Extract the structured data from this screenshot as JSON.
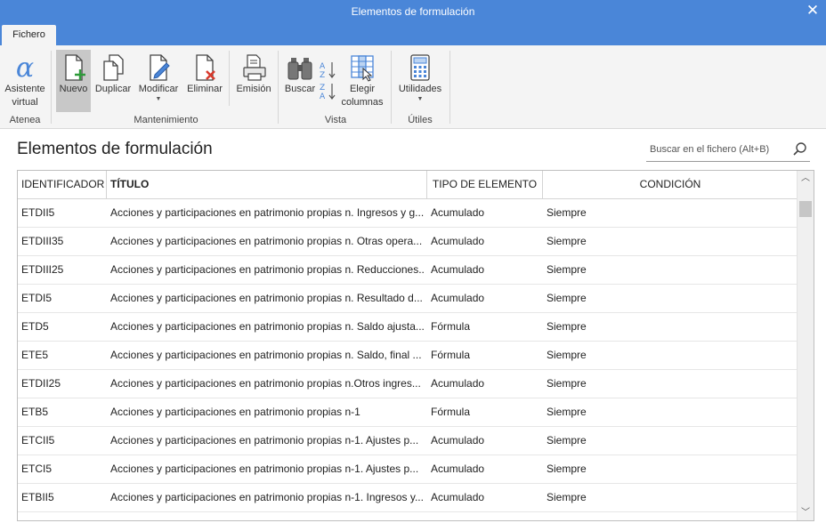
{
  "window": {
    "title": "Elementos de formulación",
    "close_glyph": "✕"
  },
  "tabs": [
    {
      "label": "Fichero"
    }
  ],
  "ribbon": {
    "groups": [
      {
        "label": "Atenea"
      },
      {
        "label": "Mantenimiento"
      },
      {
        "label": "Vista"
      },
      {
        "label": "Útiles"
      }
    ],
    "buttons": {
      "asistente": {
        "label1": "Asistente",
        "label2": "virtual",
        "icon": "alpha-icon"
      },
      "nuevo": {
        "label": "Nuevo",
        "icon": "new-document-icon"
      },
      "duplicar": {
        "label": "Duplicar",
        "icon": "duplicate-icon"
      },
      "modificar": {
        "label": "Modificar",
        "icon": "edit-document-icon"
      },
      "eliminar": {
        "label": "Eliminar",
        "icon": "delete-document-icon"
      },
      "emision": {
        "label": "Emisión",
        "icon": "printer-icon"
      },
      "buscar": {
        "label": "Buscar",
        "icon": "binoculars-icon"
      },
      "ordenar": {
        "icon": "sort-az-icon"
      },
      "elegir": {
        "label1": "Elegir",
        "label2": "columnas",
        "icon": "choose-columns-icon"
      },
      "utilidades": {
        "label": "Utilidades",
        "icon": "calculator-icon"
      }
    },
    "accent_green": "#2e9b3a",
    "accent_red": "#d83b2e",
    "accent_blue": "#4a86d8"
  },
  "page": {
    "heading": "Elementos de formulación",
    "search_placeholder": "Buscar en el fichero (Alt+B)"
  },
  "table": {
    "columns": [
      "IDENTIFICADOR",
      "TÍTULO",
      "TIPO DE ELEMENTO",
      "CONDICIÓN"
    ],
    "rows": [
      [
        "ETDII5",
        "Acciones y participaciones en patrimonio propias n. Ingresos y g...",
        "Acumulado",
        "Siempre"
      ],
      [
        "ETDIII35",
        "Acciones y participaciones en patrimonio propias n. Otras opera...",
        "Acumulado",
        "Siempre"
      ],
      [
        "ETDIII25",
        "Acciones y participaciones en patrimonio propias n. Reducciones...",
        "Acumulado",
        "Siempre"
      ],
      [
        "ETDI5",
        "Acciones y participaciones en patrimonio propias n. Resultado d...",
        "Acumulado",
        "Siempre"
      ],
      [
        "ETD5",
        "Acciones y participaciones en patrimonio propias n. Saldo ajusta...",
        "Fórmula",
        "Siempre"
      ],
      [
        "ETE5",
        "Acciones y participaciones en patrimonio propias n. Saldo, final ...",
        "Fórmula",
        "Siempre"
      ],
      [
        "ETDII25",
        "Acciones y participaciones en patrimonio propias n.Otros ingres...",
        "Acumulado",
        "Siempre"
      ],
      [
        "ETB5",
        "Acciones y participaciones en patrimonio propias n-1",
        "Fórmula",
        "Siempre"
      ],
      [
        "ETCII5",
        "Acciones y participaciones en patrimonio propias n-1.   Ajustes p...",
        "Acumulado",
        "Siempre"
      ],
      [
        "ETCI5",
        "Acciones y participaciones en patrimonio propias n-1.  Ajustes p...",
        "Acumulado",
        "Siempre"
      ],
      [
        "ETBII5",
        "Acciones y participaciones en patrimonio propias n-1.  Ingresos y...",
        "Acumulado",
        "Siempre"
      ]
    ]
  }
}
